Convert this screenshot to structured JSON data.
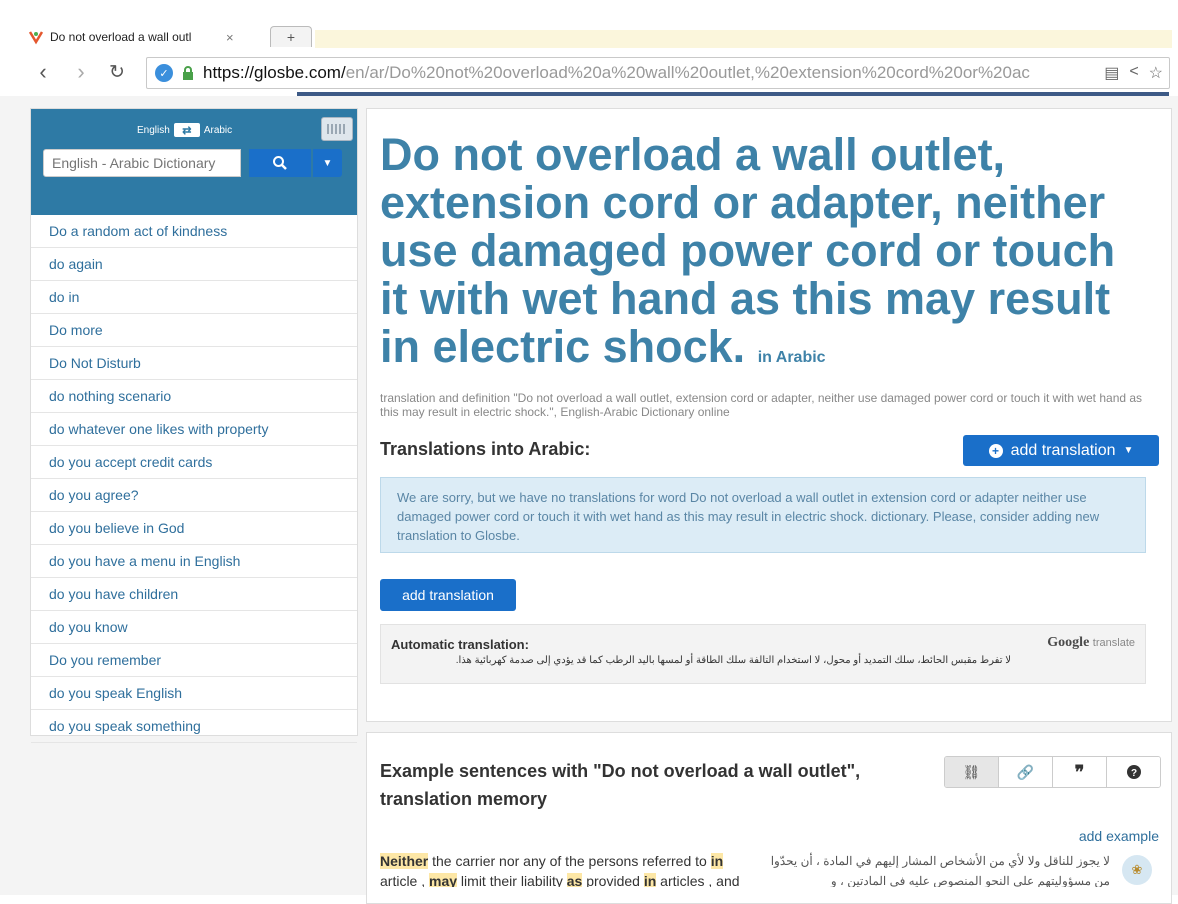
{
  "browser": {
    "tab_title": "Do not overload a wall outl",
    "new_tab": "+",
    "url_host": "https://glosbe.com/",
    "url_path": "en/ar/Do%20not%20overload%20a%20wall%20outlet,%20extension%20cord%20or%20ac"
  },
  "sidebar": {
    "lang_from": "English",
    "lang_to": "Arabic",
    "search_placeholder": "English - Arabic Dictionary",
    "items": [
      "Do a random act of kindness",
      "do again",
      "do in",
      "Do more",
      "Do Not Disturb",
      "do nothing scenario",
      "do whatever one likes with property",
      "do you accept credit cards",
      "do you agree?",
      "do you believe in God",
      "do you have a menu in English",
      "do you have children",
      "do you know",
      "Do you remember",
      "do you speak English",
      "do you speak something"
    ]
  },
  "main": {
    "heading": "Do not overload a wall outlet, extension cord or adapter, neither use damaged power cord or touch it with wet hand as this may result in electric shock.",
    "heading_suffix": "in Arabic",
    "definition": "translation and definition \"Do not overload a wall outlet, extension cord or adapter, neither use damaged power cord or touch it with wet hand as this may result in electric shock.\", English-Arabic Dictionary  online",
    "translations_title": "Translations into Arabic:",
    "add_translation_dropdown": "add translation",
    "notice": "We are sorry, but we have no translations for word Do not overload a wall outlet in extension cord or adapter neither use damaged power cord or touch it with wet hand as this may result in electric shock. dictionary. Please, consider adding new translation to Glosbe.",
    "add_translation_button": "add translation",
    "auto_label": "Automatic translation:",
    "auto_text": "لا تفرط مقبس الحائط، سلك التمديد أو محول، لا استخدام التالفة سلك الطاقة أو لمسها باليد الرطب كما قد يؤدي إلى صدمة كهربائية هذا.",
    "google": "Google",
    "translate": "translate"
  },
  "examples": {
    "title": "Example sentences with \"Do not overload a wall outlet\", translation memory",
    "add_example": "add example",
    "en_parts": [
      "Neither",
      " the carrier nor any of the persons referred to ",
      "in",
      " article , ",
      "may",
      " limit their liability ",
      "as",
      " provided ",
      "in",
      " articles , and"
    ],
    "ar": "لا يجوز للناقل ولا لأي من الأشخاص المشار إليهم في المادة ، أن يحدّوا من مسؤوليتهم على النحو المنصوص عليه في المادتين ، و"
  },
  "colors": {
    "brand": "#2e7aa5",
    "link": "#2f6f9c",
    "button": "#1a6fc9",
    "heading": "#3e82a8"
  }
}
